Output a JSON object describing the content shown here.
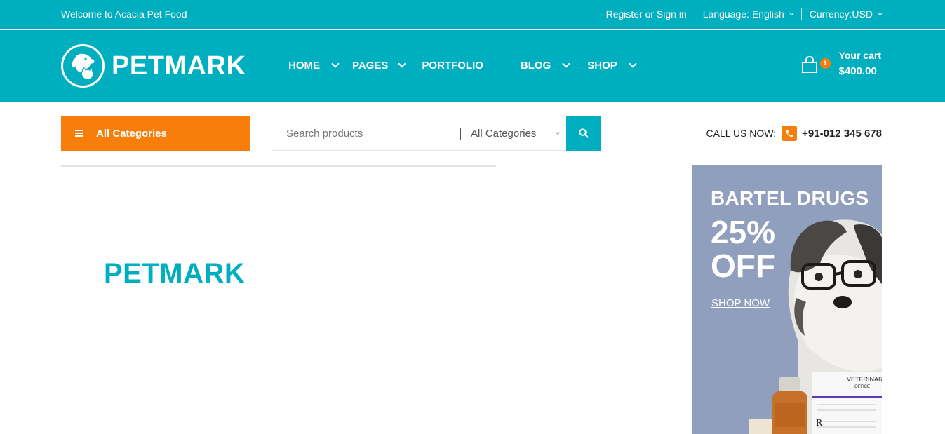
{
  "topbar": {
    "welcome": "Welcome to Acacia Pet Food",
    "register": "Register or Sign in",
    "language": "Language: English",
    "currency": "Currency:USD"
  },
  "header": {
    "logo_text": "PETMARK",
    "nav": [
      {
        "label": "HOME",
        "has_dropdown": true
      },
      {
        "label": "PAGES",
        "has_dropdown": true
      },
      {
        "label": "PORTFOLIO",
        "has_dropdown": false
      },
      {
        "label": "BLOG",
        "has_dropdown": true
      },
      {
        "label": "SHOP",
        "has_dropdown": true
      }
    ],
    "cart": {
      "count": "1",
      "label": "Your cart",
      "amount": "$400.00"
    }
  },
  "search": {
    "all_categories_label": "All Categories",
    "placeholder": "Search products",
    "category_select": "All Categories"
  },
  "call": {
    "label": "CALL US NOW:",
    "number": "+91-012 345 678"
  },
  "main": {
    "title": "PETMARK"
  },
  "banner": {
    "title": "BARTEL DRUGS",
    "discount_line1": "25%",
    "discount_line2": "OFF",
    "cta": "SHOP NOW",
    "card_title": "VETERINAR",
    "card_subtitle": "OFFICE"
  },
  "colors": {
    "primary": "#00afbf",
    "accent": "#f77e0b",
    "banner_bg": "#8f9fbd"
  },
  "icons": {
    "logo": "dog-cat-logo-icon",
    "cart": "shopping-bag-icon",
    "menu": "hamburger-icon",
    "search": "search-icon",
    "phone": "phone-icon"
  }
}
